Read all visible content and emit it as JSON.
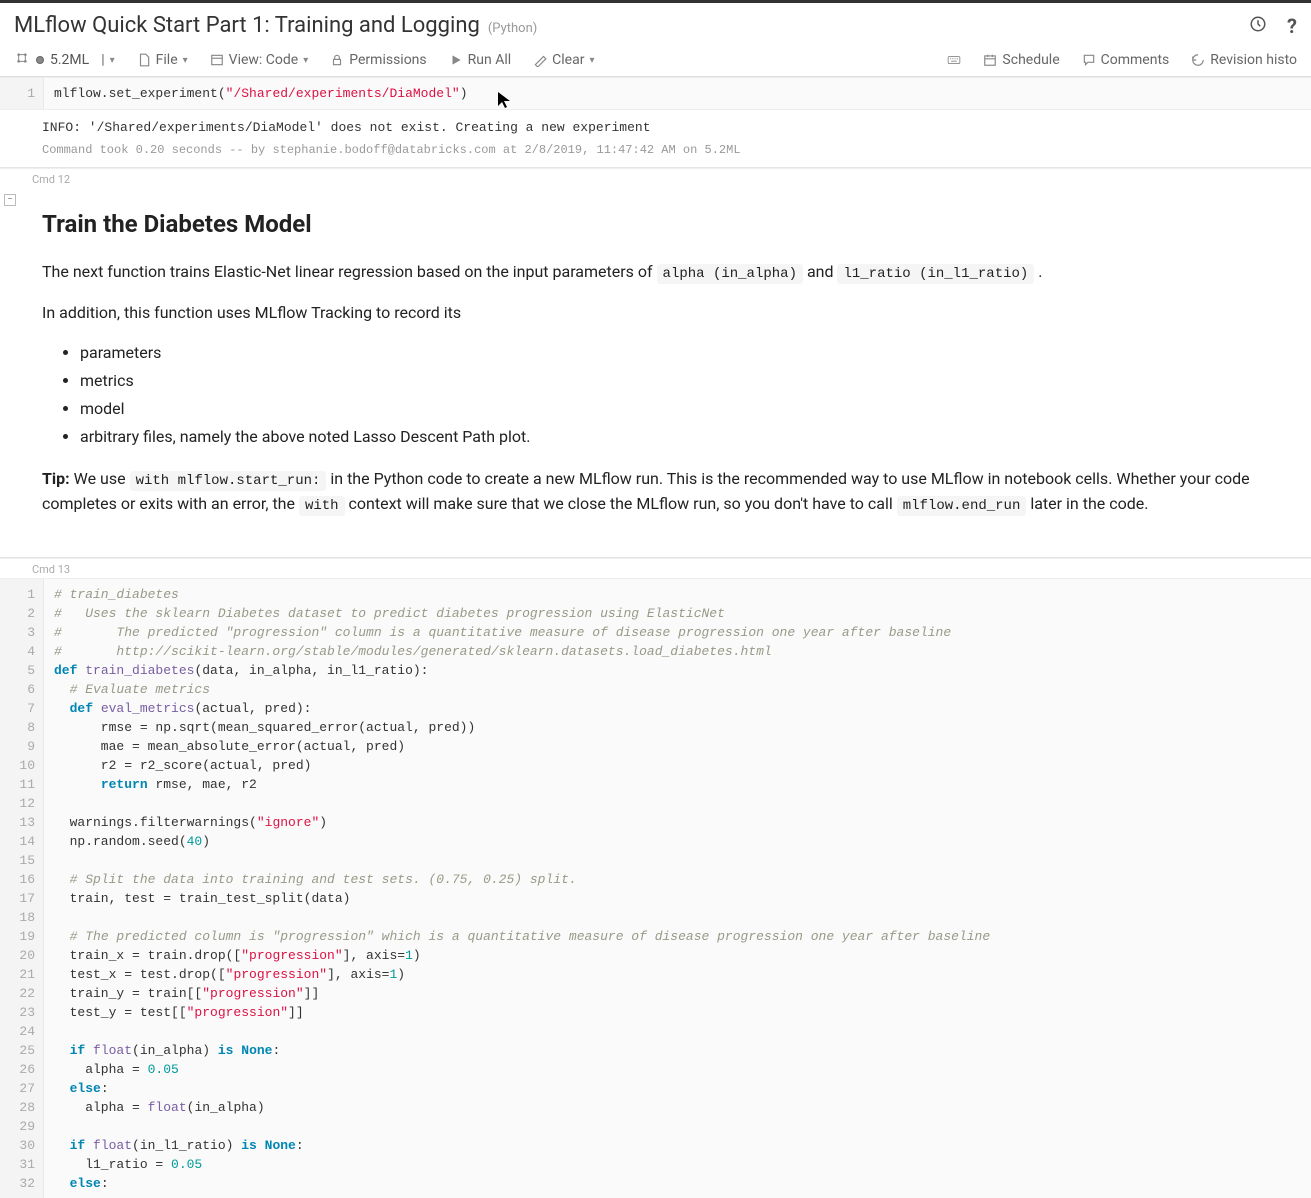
{
  "header": {
    "title": "MLflow Quick Start Part 1: Training and Logging",
    "language": "(Python)"
  },
  "toolbar": {
    "cluster": "5.2ML",
    "file": "File",
    "view": "View: Code",
    "permissions": "Permissions",
    "run_all": "Run All",
    "clear": "Clear",
    "schedule": "Schedule",
    "comments": "Comments",
    "revision": "Revision histo"
  },
  "cell11": {
    "code": [
      {
        "n": "1",
        "tokens": [
          [
            "mlflow.set_experiment(",
            ""
          ],
          [
            "\"/Shared/experiments/DiaModel\"",
            "c-str"
          ],
          [
            ")",
            ""
          ]
        ]
      }
    ],
    "output": "INFO: '/Shared/experiments/DiaModel' does not exist. Creating a new experiment",
    "meta": "Command took 0.20 seconds -- by stephanie.bodoff@databricks.com at 2/8/2019, 11:47:42 AM on 5.2ML"
  },
  "cell12": {
    "label": "Cmd 12",
    "md": {
      "h2": "Train the Diabetes Model",
      "p1a": "The next function trains Elastic-Net linear regression based on the input parameters of ",
      "p1code1": "alpha (in_alpha)",
      "p1b": " and ",
      "p1code2": "l1_ratio (in_l1_ratio)",
      "p1c": " .",
      "p2": "In addition, this function uses MLflow Tracking to record its",
      "li1": "parameters",
      "li2": "metrics",
      "li3": "model",
      "li4": "arbitrary files, namely the above noted Lasso Descent Path plot.",
      "tip_label": "Tip:",
      "tip_a": " We use ",
      "tip_code1": "with mlflow.start_run:",
      "tip_b": " in the Python code to create a new MLflow run. This is the recommended way to use MLflow in notebook cells. Whether your code completes or exits with an error, the ",
      "tip_code2": "with",
      "tip_c": " context will make sure that we close the MLflow run, so you don't have to call ",
      "tip_code3": "mlflow.end_run",
      "tip_d": " later in the code."
    }
  },
  "cell13": {
    "label": "Cmd 13",
    "code": [
      {
        "n": "1",
        "tokens": [
          [
            "# train_diabetes",
            "c-cmt"
          ]
        ]
      },
      {
        "n": "2",
        "tokens": [
          [
            "#   Uses the sklearn Diabetes dataset to predict diabetes progression using ElasticNet",
            "c-cmt"
          ]
        ]
      },
      {
        "n": "3",
        "tokens": [
          [
            "#       The predicted \"progression\" column is a quantitative measure of disease progression one year after baseline",
            "c-cmt"
          ]
        ]
      },
      {
        "n": "4",
        "tokens": [
          [
            "#       http://scikit-learn.org/stable/modules/generated/sklearn.datasets.load_diabetes.html",
            "c-cmt"
          ]
        ]
      },
      {
        "n": "5",
        "tokens": [
          [
            "def ",
            "c-kw"
          ],
          [
            "train_diabetes",
            "c-fn"
          ],
          [
            "(data, in_alpha, in_l1_ratio):",
            ""
          ]
        ]
      },
      {
        "n": "6",
        "tokens": [
          [
            "  ",
            ""
          ],
          [
            "# Evaluate metrics",
            "c-cmt"
          ]
        ]
      },
      {
        "n": "7",
        "tokens": [
          [
            "  ",
            ""
          ],
          [
            "def ",
            "c-kw"
          ],
          [
            "eval_metrics",
            "c-fn"
          ],
          [
            "(actual, pred):",
            ""
          ]
        ]
      },
      {
        "n": "8",
        "tokens": [
          [
            "      rmse = np.sqrt(mean_squared_error(actual, pred))",
            ""
          ]
        ]
      },
      {
        "n": "9",
        "tokens": [
          [
            "      mae = mean_absolute_error(actual, pred)",
            ""
          ]
        ]
      },
      {
        "n": "10",
        "tokens": [
          [
            "      r2 = r2_score(actual, pred)",
            ""
          ]
        ]
      },
      {
        "n": "11",
        "tokens": [
          [
            "      ",
            ""
          ],
          [
            "return ",
            "c-kw"
          ],
          [
            "rmse, mae, r2",
            ""
          ]
        ]
      },
      {
        "n": "12",
        "tokens": [
          [
            "",
            ""
          ]
        ]
      },
      {
        "n": "13",
        "tokens": [
          [
            "  warnings.filterwarnings(",
            ""
          ],
          [
            "\"ignore\"",
            "c-str"
          ],
          [
            ")",
            ""
          ]
        ]
      },
      {
        "n": "14",
        "tokens": [
          [
            "  np.random.seed(",
            ""
          ],
          [
            "40",
            "c-num"
          ],
          [
            ")",
            ""
          ]
        ]
      },
      {
        "n": "15",
        "tokens": [
          [
            "",
            ""
          ]
        ]
      },
      {
        "n": "16",
        "tokens": [
          [
            "  ",
            ""
          ],
          [
            "# Split the data into training and test sets. (0.75, 0.25) split.",
            "c-cmt"
          ]
        ]
      },
      {
        "n": "17",
        "tokens": [
          [
            "  train, test = train_test_split(data)",
            ""
          ]
        ]
      },
      {
        "n": "18",
        "tokens": [
          [
            "",
            ""
          ]
        ]
      },
      {
        "n": "19",
        "tokens": [
          [
            "  ",
            ""
          ],
          [
            "# The predicted column is \"progression\" which is a quantitative measure of disease progression one year after baseline",
            "c-cmt"
          ]
        ]
      },
      {
        "n": "20",
        "tokens": [
          [
            "  train_x = train.drop([",
            ""
          ],
          [
            "\"progression\"",
            "c-str"
          ],
          [
            "], axis=",
            ""
          ],
          [
            "1",
            "c-num"
          ],
          [
            ")",
            ""
          ]
        ]
      },
      {
        "n": "21",
        "tokens": [
          [
            "  test_x = test.drop([",
            ""
          ],
          [
            "\"progression\"",
            "c-str"
          ],
          [
            "], axis=",
            ""
          ],
          [
            "1",
            "c-num"
          ],
          [
            ")",
            ""
          ]
        ]
      },
      {
        "n": "22",
        "tokens": [
          [
            "  train_y = train[[",
            ""
          ],
          [
            "\"progression\"",
            "c-str"
          ],
          [
            "]]",
            ""
          ]
        ]
      },
      {
        "n": "23",
        "tokens": [
          [
            "  test_y = test[[",
            ""
          ],
          [
            "\"progression\"",
            "c-str"
          ],
          [
            "]]",
            ""
          ]
        ]
      },
      {
        "n": "24",
        "tokens": [
          [
            "",
            ""
          ]
        ]
      },
      {
        "n": "25",
        "tokens": [
          [
            "  ",
            ""
          ],
          [
            "if ",
            "c-kw"
          ],
          [
            "float",
            "c-fn"
          ],
          [
            "(in_alpha) ",
            ""
          ],
          [
            "is ",
            "c-kw"
          ],
          [
            "None",
            "c-bool"
          ],
          [
            ":",
            ""
          ]
        ]
      },
      {
        "n": "26",
        "tokens": [
          [
            "    alpha = ",
            ""
          ],
          [
            "0.05",
            "c-num"
          ]
        ]
      },
      {
        "n": "27",
        "tokens": [
          [
            "  ",
            ""
          ],
          [
            "else",
            "c-kw"
          ],
          [
            ":",
            ""
          ]
        ]
      },
      {
        "n": "28",
        "tokens": [
          [
            "    alpha = ",
            ""
          ],
          [
            "float",
            "c-fn"
          ],
          [
            "(in_alpha)",
            ""
          ]
        ]
      },
      {
        "n": "29",
        "tokens": [
          [
            "",
            ""
          ]
        ]
      },
      {
        "n": "30",
        "tokens": [
          [
            "  ",
            ""
          ],
          [
            "if ",
            "c-kw"
          ],
          [
            "float",
            "c-fn"
          ],
          [
            "(in_l1_ratio) ",
            ""
          ],
          [
            "is ",
            "c-kw"
          ],
          [
            "None",
            "c-bool"
          ],
          [
            ":",
            ""
          ]
        ]
      },
      {
        "n": "31",
        "tokens": [
          [
            "    l1_ratio = ",
            ""
          ],
          [
            "0.05",
            "c-num"
          ]
        ]
      },
      {
        "n": "32",
        "tokens": [
          [
            "  ",
            ""
          ],
          [
            "else",
            "c-kw"
          ],
          [
            ":",
            ""
          ]
        ]
      }
    ]
  }
}
